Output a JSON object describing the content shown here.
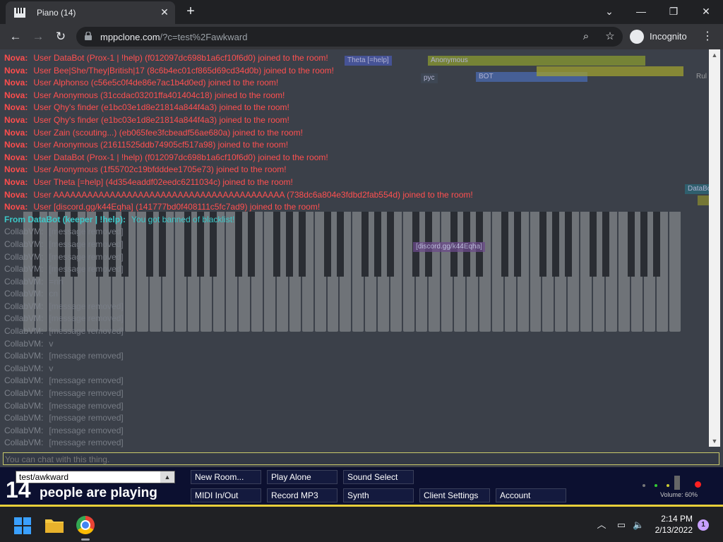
{
  "browser": {
    "tab_title": "Piano (14)",
    "tab_close": "✕",
    "new_tab": "+",
    "url_host": "mppclone.com",
    "url_path": "/?c=test%2Fawkward",
    "incognito_label": "Incognito"
  },
  "icons": {
    "piano": "piano-icon",
    "back": "back-arrow-icon",
    "forward": "forward-arrow-icon",
    "reload": "reload-icon",
    "lock": "lock-icon",
    "zoom": "zoom-icon",
    "star": "star-icon",
    "incognito": "incognito-icon",
    "menu": "kebab-menu-icon",
    "minimize": "minimize-icon",
    "restore": "restore-icon",
    "close": "close-icon",
    "tab_search": "tab-search-icon",
    "start": "windows-start-icon",
    "folder": "folder-icon",
    "chrome": "chrome-icon",
    "chevron": "chevron-up-icon",
    "network": "network-icon",
    "volume": "volume-icon"
  },
  "chat": [
    {
      "type": "nova",
      "name": "Nova:",
      "text": "User DataBot (Prox-1 | !help) (f012097dc698b1a6cf10f6d0) joined to the room!"
    },
    {
      "type": "nova",
      "name": "Nova:",
      "text": "User Bee|She/They|British|17 (8c6b4ec01cf865d69cd34d0b) joined to the room!"
    },
    {
      "type": "nova",
      "name": "Nova:",
      "text": "User Alphonso (c56e5c0f4de86e7ac1b4d0ed) joined to the room!"
    },
    {
      "type": "nova",
      "name": "Nova:",
      "text": "User Anonymous (31ccdac03201ffa401404c18) joined to the room!"
    },
    {
      "type": "nova",
      "name": "Nova:",
      "text": "User Qhy's finder (e1bc03e1d8e21814a844f4a3) joined to the room!"
    },
    {
      "type": "nova",
      "name": "Nova:",
      "text": "User Qhy's finder (e1bc03e1d8e21814a844f4a3) joined to the room!"
    },
    {
      "type": "nova",
      "name": "Nova:",
      "text": "User Zain (scouting...) (eb065fee3fcbeadf56ae680a) joined to the room!"
    },
    {
      "type": "nova",
      "name": "Nova:",
      "text": "User Anonymous (21611525ddb74905cf517a98) joined to the room!"
    },
    {
      "type": "nova",
      "name": "Nova:",
      "text": "User DataBot (Prox-1 | !help) (f012097dc698b1a6cf10f6d0) joined to the room!"
    },
    {
      "type": "nova",
      "name": "Nova:",
      "text": "User Anonymous (1f55702c19bfdddee1705e73) joined to the room!"
    },
    {
      "type": "nova",
      "name": "Nova:",
      "text": "User Theta [=help] (4d354eaddf02eedc6211034c) joined to the room!"
    },
    {
      "type": "nova",
      "name": "Nova:",
      "text": "User AAAAAAAAAAAAAAAAAAAAAAAAAAAAAAAAAAAAAAAAA (738dc6a804e3fdbd2fab554d) joined to the room!"
    },
    {
      "type": "nova",
      "name": "Nova:",
      "text": "User [discord.gg/k44Eqha] (141777bd0f408111c5fc7ad9) joined to the room!"
    },
    {
      "type": "from",
      "name": "From DataBot (keeper | !help):",
      "text": "You got banned of blacklist!"
    },
    {
      "type": "collab",
      "name": "CollabVM:",
      "text": "[message removed]"
    },
    {
      "type": "collab",
      "name": "CollabVM:",
      "text": "[message removed]"
    },
    {
      "type": "collab",
      "name": "CollabVM:",
      "text": "[message removed]"
    },
    {
      "type": "collab",
      "name": "CollabVM:",
      "text": "[message removed]"
    },
    {
      "type": "collab",
      "name": "CollabVM:",
      "text": "=nn"
    },
    {
      "type": "collab",
      "name": "CollabVM:",
      "text": "cn"
    },
    {
      "type": "collab",
      "name": "CollabVM:",
      "text": "[message removed]"
    },
    {
      "type": "collab",
      "name": "CollabVM:",
      "text": "[message removed]"
    },
    {
      "type": "collab",
      "name": "CollabVM:",
      "text": "[message removed]"
    },
    {
      "type": "collab",
      "name": "CollabVM:",
      "text": "v"
    },
    {
      "type": "collab",
      "name": "CollabVM:",
      "text": "[message removed]"
    },
    {
      "type": "collab",
      "name": "CollabVM:",
      "text": "v"
    },
    {
      "type": "collab",
      "name": "CollabVM:",
      "text": "[message removed]"
    },
    {
      "type": "collab",
      "name": "CollabVM:",
      "text": "[message removed]"
    },
    {
      "type": "collab",
      "name": "CollabVM:",
      "text": "[message removed]"
    },
    {
      "type": "collab",
      "name": "CollabVM:",
      "text": "[message removed]"
    },
    {
      "type": "collab",
      "name": "CollabVM:",
      "text": "[message removed]"
    },
    {
      "type": "collab",
      "name": "CollabVM:",
      "text": "[message removed]"
    }
  ],
  "overlays": {
    "cursor_label": "[discord.gg/k44Eqha]",
    "strip_1": "Theta [=help]",
    "strip_2": "Anonymous",
    "strip_3": "pyc",
    "strip_4": "BOT",
    "strip_5": "DataBo",
    "strip_6": "Rul"
  },
  "chat_input": {
    "placeholder": "You can chat with this thing."
  },
  "controls": {
    "room_value": "test/awkward",
    "players_count": "14",
    "players_label": "people are playing",
    "new_room": "New Room...",
    "play_alone": "Play Alone",
    "sound_select": "Sound Select",
    "midi": "MIDI In/Out",
    "record": "Record MP3",
    "synth": "Synth",
    "client_settings": "Client Settings",
    "account": "Account",
    "volume": "Volume: 60%"
  },
  "taskbar": {
    "time": "2:14 PM",
    "date": "2/13/2022",
    "notifications": "1"
  },
  "colors": {
    "nova": "#ff4d4d",
    "from": "#3cc8c8",
    "collab": "#777c85",
    "accent_border": "#e8cf3a"
  }
}
